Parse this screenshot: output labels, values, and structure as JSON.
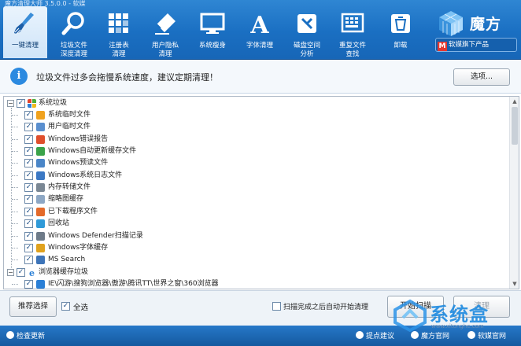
{
  "window": {
    "title": "魔方清理大师 3.5.0.0 - 软媒"
  },
  "toolbar": {
    "tools": [
      {
        "label": "一键清理",
        "icon": "broom-icon"
      },
      {
        "label": "垃圾文件\n深度清理",
        "icon": "magnifier-icon"
      },
      {
        "label": "注册表\n清理",
        "icon": "registry-grid-icon"
      },
      {
        "label": "用户隐私\n清理",
        "icon": "privacy-eraser-icon"
      },
      {
        "label": "系统瘦身",
        "icon": "monitor-icon"
      },
      {
        "label": "字体清理",
        "icon": "font-a-icon"
      },
      {
        "label": "磁盘空间\n分析",
        "icon": "disk-analyze-icon"
      },
      {
        "label": "重复文件\n查找",
        "icon": "duplicate-file-icon"
      },
      {
        "label": "卸载",
        "icon": "recycle-bin-icon"
      }
    ],
    "brand": {
      "name": "魔方",
      "tagline": "软媒旗下产品",
      "tag_badge": "M"
    }
  },
  "notice": {
    "message": "垃圾文件过多会拖慢系统速度，建议定期清理！",
    "options_button": "选项..."
  },
  "tree": {
    "groups": [
      {
        "label": "系统垃圾",
        "checked": true,
        "icon": "windows-logo-icon",
        "items": [
          {
            "label": "系统临时文件",
            "icon": "windows-flag-icon"
          },
          {
            "label": "用户临时文件",
            "icon": "user-folder-icon"
          },
          {
            "label": "Windows错误报告",
            "icon": "error-report-icon"
          },
          {
            "label": "Windows自动更新缓存文件",
            "icon": "windows-update-icon"
          },
          {
            "label": "Windows预读文件",
            "icon": "prefetch-icon"
          },
          {
            "label": "Windows系统日志文件",
            "icon": "log-file-icon"
          },
          {
            "label": "内存转储文件",
            "icon": "memory-dump-icon"
          },
          {
            "label": "缩略图缓存",
            "icon": "thumbnail-icon"
          },
          {
            "label": "已下载程序文件",
            "icon": "download-icon"
          },
          {
            "label": "回收站",
            "icon": "recycle-icon"
          },
          {
            "label": "Windows Defender扫描记录",
            "icon": "defender-icon"
          },
          {
            "label": "Windows字体缓存",
            "icon": "font-cache-icon"
          },
          {
            "label": "MS Search",
            "icon": "search-icon"
          }
        ]
      },
      {
        "label": "浏览器缓存垃圾",
        "checked": true,
        "icon": "ie-browser-icon",
        "items": [
          {
            "label": "IE\\闪游\\搜狗浏览器\\傲游\\腾讯TT\\世界之窗\\360浏览器",
            "icon": "ie-browser-icon"
          }
        ]
      }
    ]
  },
  "actions": {
    "recommend_button": "推荐选择",
    "select_all_label": "全选",
    "select_all_checked": true,
    "auto_clean_label": "扫描完成之后自动开始清理",
    "auto_clean_checked": false,
    "scan_button": "开始扫描",
    "clean_button": "清理"
  },
  "statusbar": {
    "check_update": "检查更新",
    "suggest": "提点建议",
    "official_site": "魔方官网",
    "software_site": "软媒官网"
  },
  "watermark": {
    "text": "系统盒",
    "url": "www.xitonghe.com"
  },
  "colors": {
    "toolbar": "#1a6fc2",
    "accent": "#2c8ae0",
    "status": "#15599f"
  }
}
